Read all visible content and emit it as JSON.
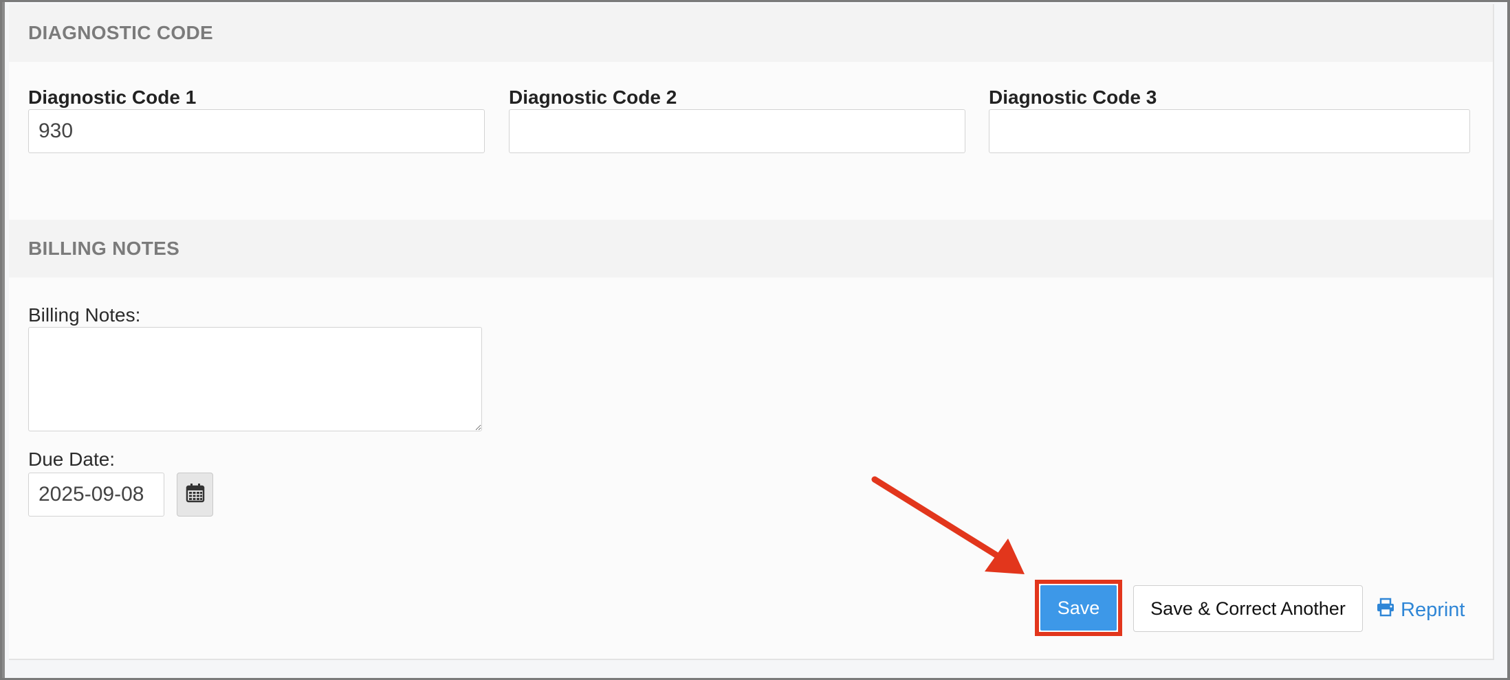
{
  "diagnostic_section": {
    "title": "DIAGNOSTIC CODE",
    "fields": [
      {
        "label": "Diagnostic Code 1",
        "value": "930"
      },
      {
        "label": "Diagnostic Code 2",
        "value": ""
      },
      {
        "label": "Diagnostic Code 3",
        "value": ""
      }
    ]
  },
  "billing_section": {
    "title": "BILLING NOTES",
    "notes_label": "Billing Notes:",
    "notes_value": "",
    "due_date_label": "Due Date:",
    "due_date_value": "2025-09-08"
  },
  "actions": {
    "save_label": "Save",
    "save_correct_label": "Save & Correct Another",
    "reprint_label": "Reprint"
  },
  "colors": {
    "primary_button": "#3d98e8",
    "highlight_border": "#e2361c",
    "link": "#2f86d6"
  },
  "icons": {
    "calendar": "calendar-icon",
    "printer": "printer-icon"
  }
}
